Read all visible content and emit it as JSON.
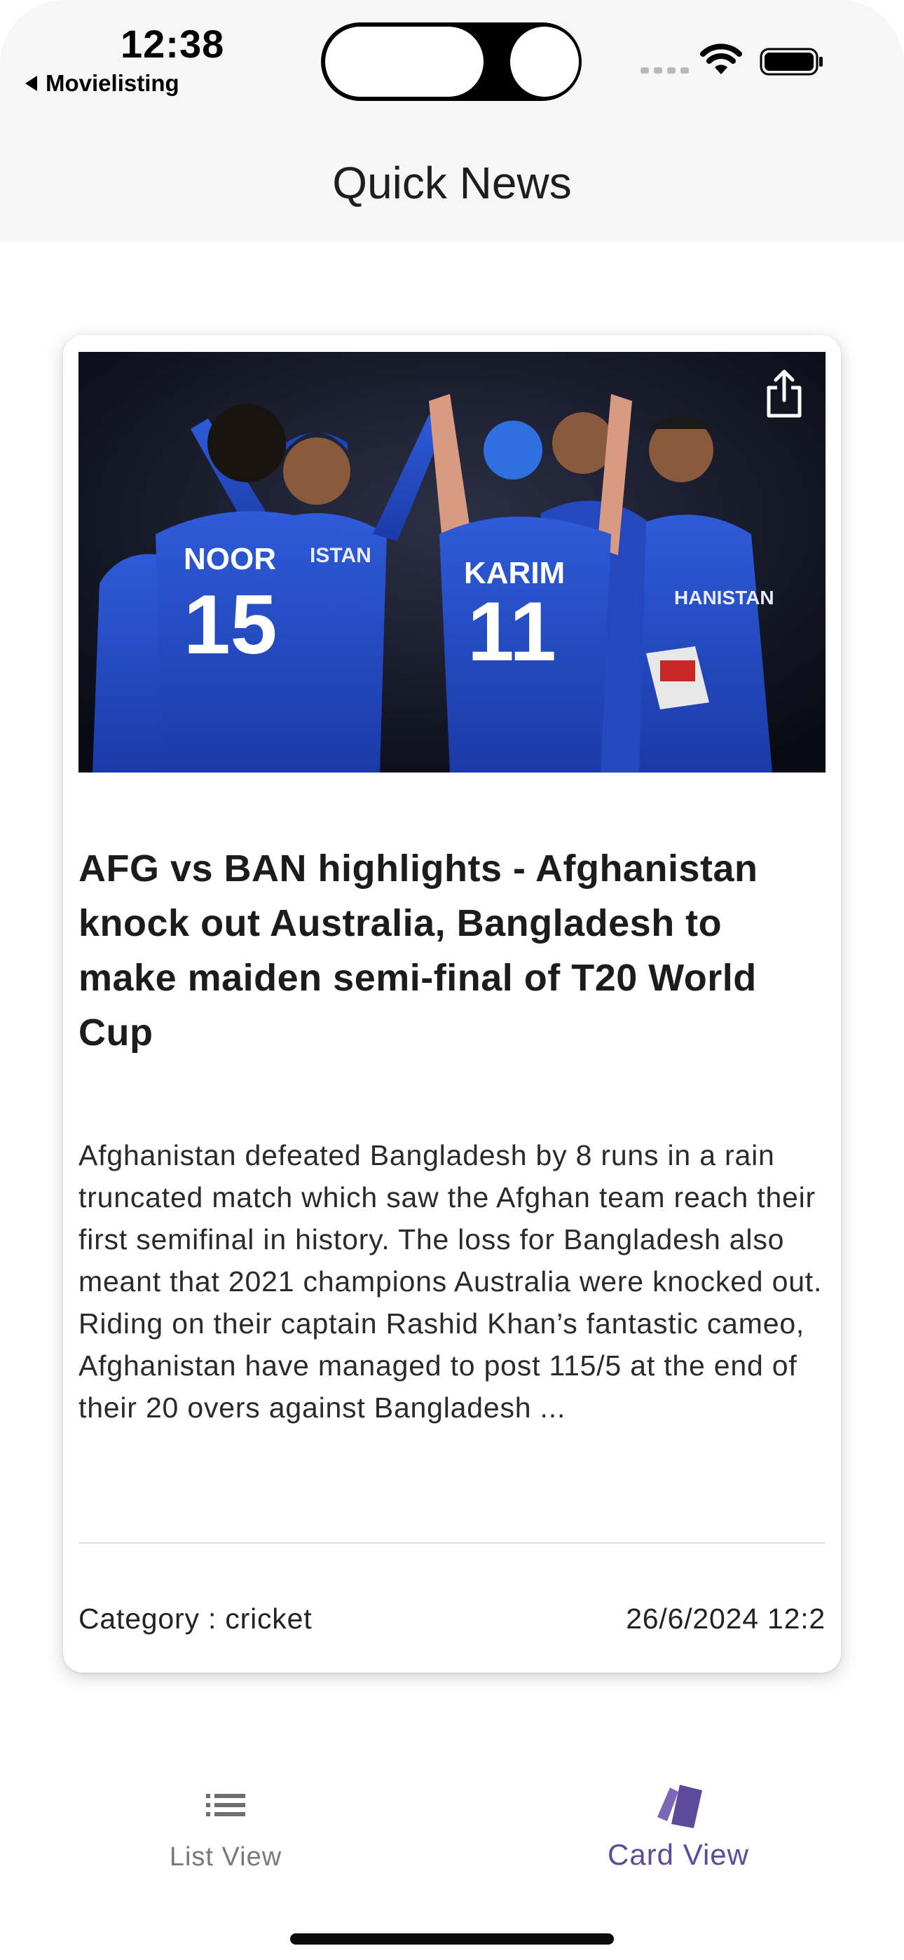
{
  "status_bar": {
    "time": "12:38",
    "back_app": "Movielisting"
  },
  "header": {
    "title": "Quick News"
  },
  "article": {
    "image_alt": "Afghanistan cricket players celebrating",
    "jersey_texts": [
      "NOOR",
      "15",
      "KARIM",
      "11",
      "ISTAN",
      "HANISTAN"
    ],
    "headline": "AFG vs BAN highlights - Afghanistan knock out Australia, Bangladesh to make maiden semi-final of T20 World Cup",
    "summary": "Afghanistan defeated Bangladesh by 8 runs in a rain truncated match which saw the Afghan team reach their first semifinal in history. The loss for Bangladesh also meant that 2021 champions Australia were knocked out.  Riding on their captain Rashid Khan’s fantastic cameo, Afghanistan have managed to post 115/5 at the end of their 20 overs against Bangladesh ...",
    "category": "Category : cricket",
    "timestamp": "26/6/2024 12:2",
    "share_icon": "share-icon"
  },
  "bottom_nav": {
    "tabs": [
      {
        "label": "List View",
        "icon": "list-icon",
        "active": false
      },
      {
        "label": "Card View",
        "icon": "cards-icon",
        "active": true
      }
    ],
    "active_color": "#5e4a9a",
    "inactive_color": "#7a7a7a"
  }
}
